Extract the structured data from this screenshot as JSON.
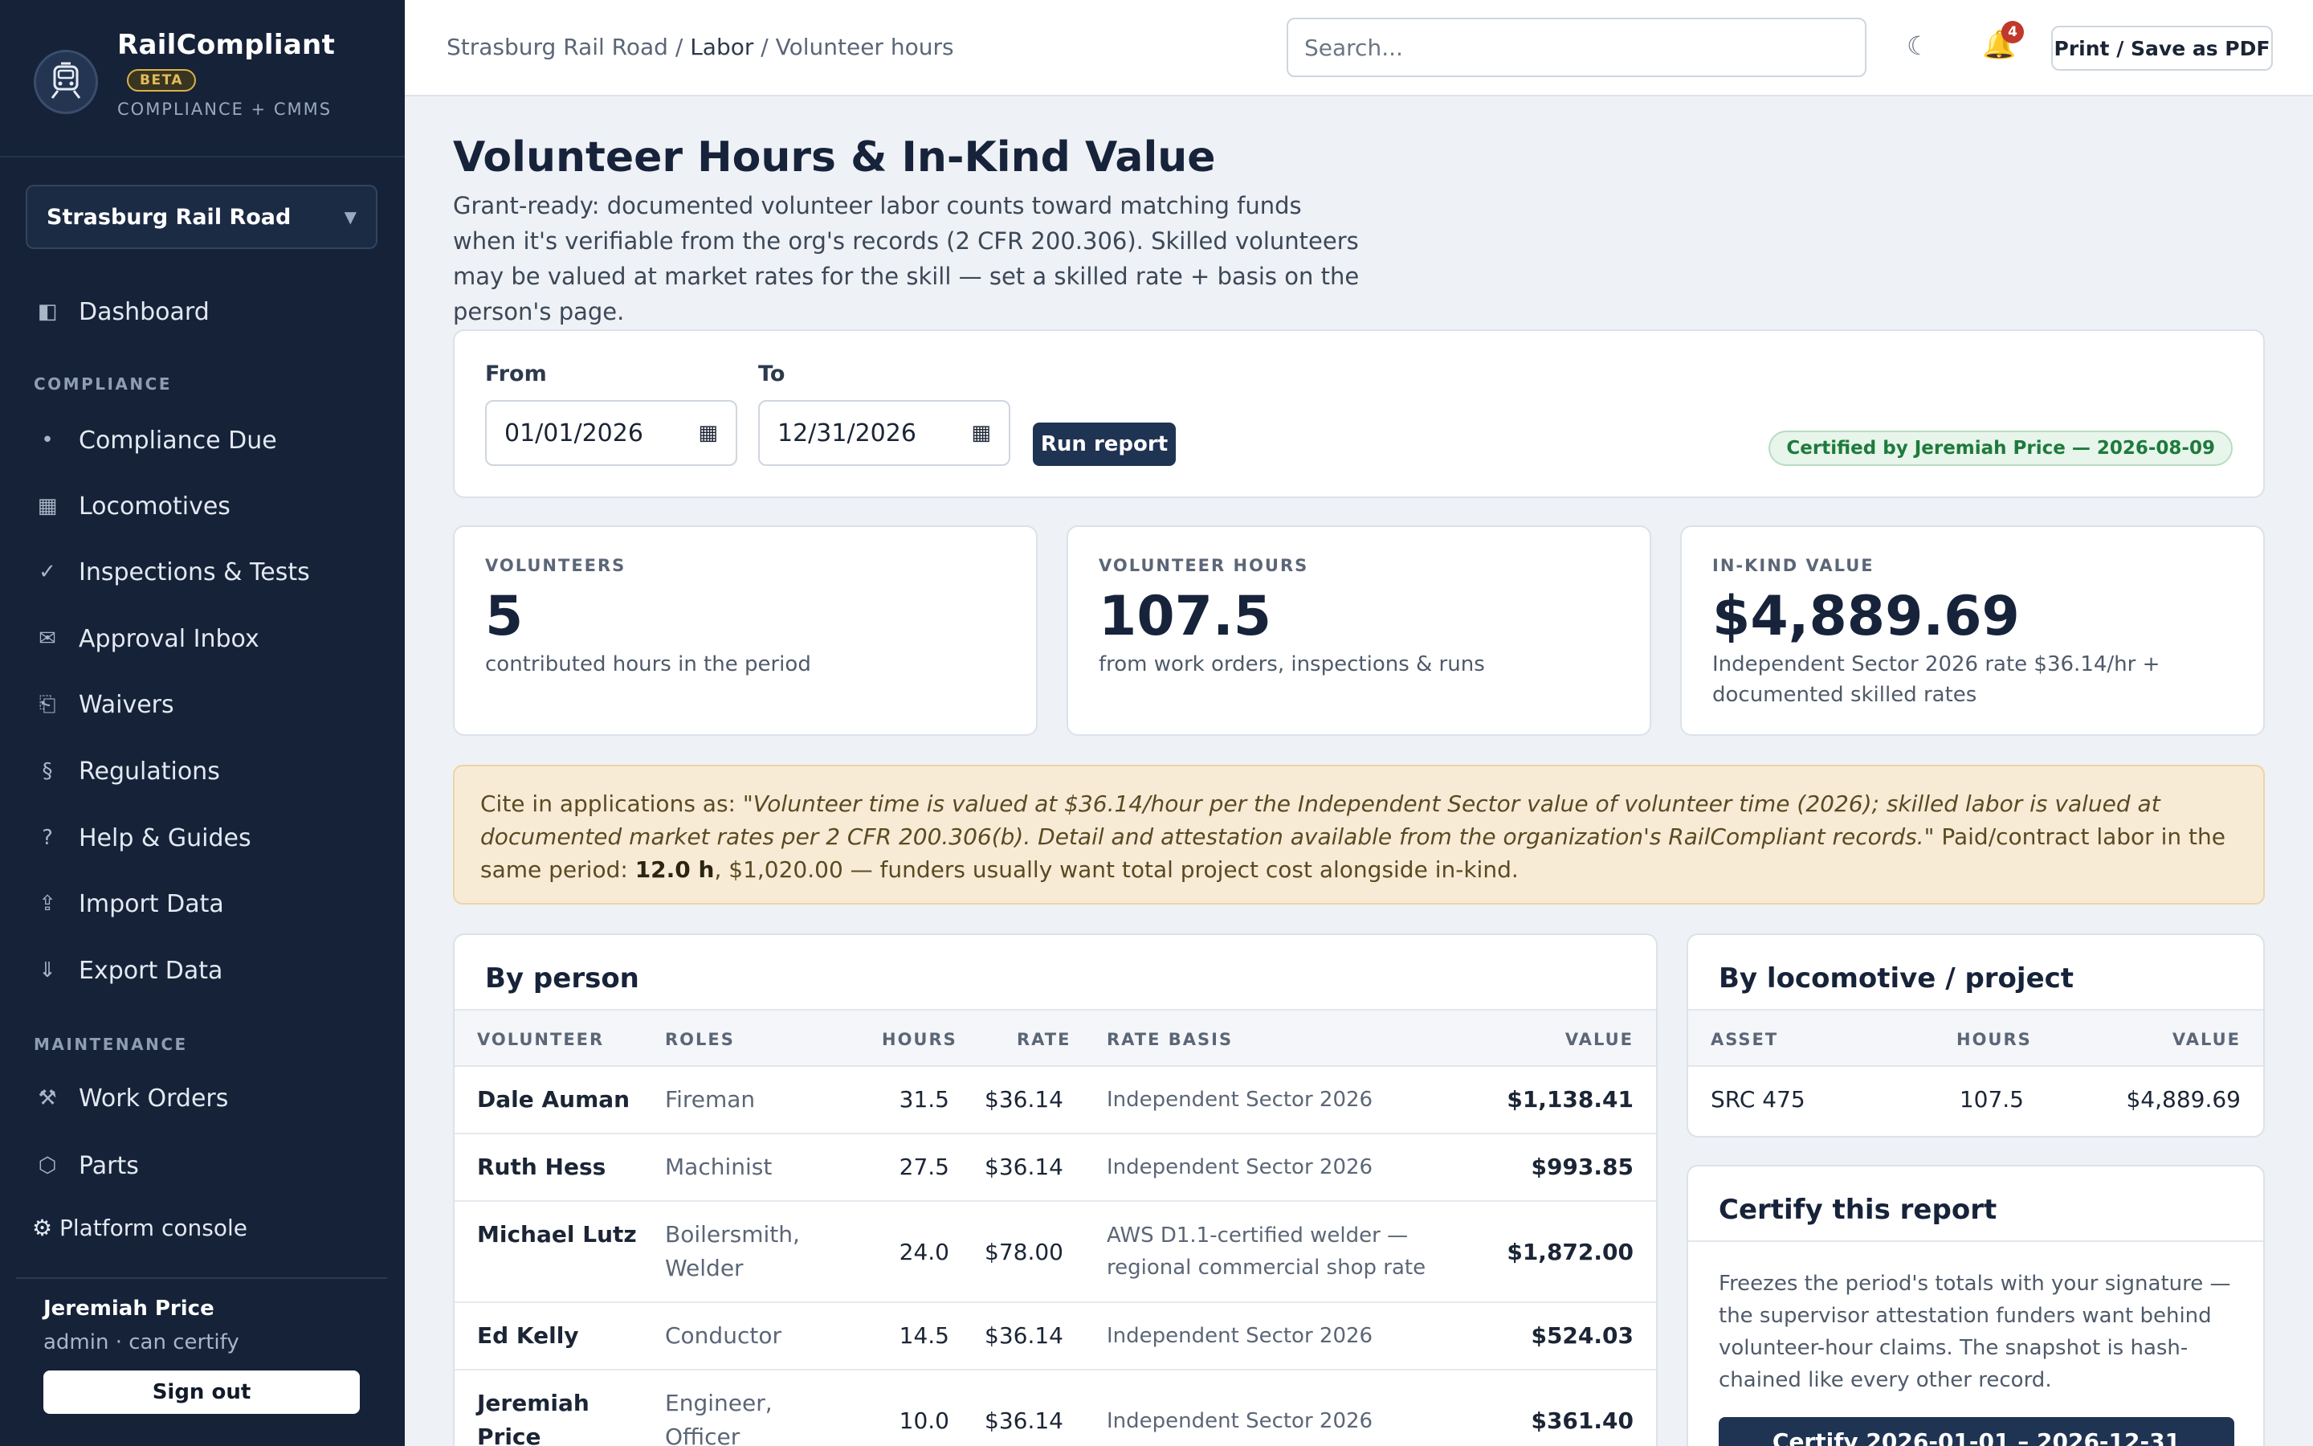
{
  "app": {
    "name": "RailCompliant",
    "beta": "BETA",
    "subtitle": "COMPLIANCE + CMMS",
    "logo_icon": "locomotive-badge-icon"
  },
  "sidebar": {
    "org": "Strasburg Rail Road",
    "items": {
      "dashboard": {
        "label": "Dashboard",
        "icon": "◧"
      },
      "compliance_due": {
        "label": "Compliance Due",
        "icon": "•"
      },
      "locomotives": {
        "label": "Locomotives",
        "icon": "▦"
      },
      "inspections": {
        "label": "Inspections & Tests",
        "icon": "✓"
      },
      "approval": {
        "label": "Approval Inbox",
        "icon": "✉"
      },
      "waivers": {
        "label": "Waivers",
        "icon": "⎗"
      },
      "regulations": {
        "label": "Regulations",
        "icon": "§"
      },
      "help": {
        "label": "Help & Guides",
        "icon": "?"
      },
      "import": {
        "label": "Import Data",
        "icon": "⇪"
      },
      "export": {
        "label": "Export Data",
        "icon": "⇓"
      },
      "work_orders": {
        "label": "Work Orders",
        "icon": "⚒"
      },
      "parts": {
        "label": "Parts",
        "icon": "⬡"
      }
    },
    "section_compliance": "COMPLIANCE",
    "section_maintenance": "MAINTENANCE",
    "platform_console": "⚙ Platform console",
    "user_name": "Jeremiah Price",
    "user_role": "admin · can certify",
    "sign_out": "Sign out"
  },
  "topbar": {
    "crumb_org": "Strasburg Rail Road /",
    "crumb_section": "Labor",
    "crumb_page": "/ Volunteer hours",
    "search_placeholder": "Search...",
    "notifications": "4",
    "print": "Print / Save as PDF"
  },
  "page": {
    "title": "Volunteer Hours & In-Kind Value",
    "description": "Grant-ready: documented volunteer labor counts toward matching funds when it's verifiable from the org's records (2 CFR 200.306). Skilled volunteers may be valued at market rates for the skill — set a skilled rate + basis on the person's page."
  },
  "filters": {
    "from_label": "From",
    "from_value": "01/01/2026",
    "to_label": "To",
    "to_value": "12/31/2026",
    "run": "Run report",
    "certified": "Certified by Jeremiah Price — 2026-08-09"
  },
  "stats": {
    "volunteers": {
      "label": "VOLUNTEERS",
      "value": "5",
      "sub": "contributed hours in the period"
    },
    "hours": {
      "label": "VOLUNTEER HOURS",
      "value": "107.5",
      "sub": "from work orders, inspections & runs"
    },
    "value": {
      "label": "IN-KIND VALUE",
      "value": "$4,889.69",
      "sub": "Independent Sector 2026 rate $36.14/hr + documented skilled rates"
    }
  },
  "notice": {
    "prefix": "Cite in applications as: ",
    "quote": "\"Volunteer time is valued at $36.14/hour per the Independent Sector value of volunteer time (2026); skilled labor is valued at documented market rates per 2 CFR 200.306(b). Detail and attestation available from the organization's RailCompliant records.\"",
    "middle": " Paid/contract labor in the same period: ",
    "paid_hours": "12.0 h",
    "suffix": ", $1,020.00 — funders usually want total project cost alongside in-kind."
  },
  "by_person": {
    "title": "By person",
    "headers": {
      "volunteer": "VOLUNTEER",
      "roles": "ROLES",
      "hours": "HOURS",
      "rate": "RATE",
      "basis": "RATE BASIS",
      "value": "VALUE"
    },
    "rows": [
      {
        "name": "Dale Auman",
        "roles": "Fireman",
        "hours": "31.5",
        "rate": "$36.14",
        "basis": "Independent Sector 2026",
        "value": "$1,138.41"
      },
      {
        "name": "Ruth Hess",
        "roles": "Machinist",
        "hours": "27.5",
        "rate": "$36.14",
        "basis": "Independent Sector 2026",
        "value": "$993.85"
      },
      {
        "name": "Michael Lutz",
        "roles": "Boilersmith, Welder",
        "hours": "24.0",
        "rate": "$78.00",
        "basis": "AWS D1.1-certified welder — regional commercial shop rate",
        "value": "$1,872.00"
      },
      {
        "name": "Ed Kelly",
        "roles": "Conductor",
        "hours": "14.5",
        "rate": "$36.14",
        "basis": "Independent Sector 2026",
        "value": "$524.03"
      },
      {
        "name": "Jeremiah Price",
        "roles": "Engineer, Officer",
        "hours": "10.0",
        "rate": "$36.14",
        "basis": "Independent Sector 2026",
        "value": "$361.40"
      }
    ]
  },
  "by_asset": {
    "title": "By locomotive / project",
    "headers": {
      "asset": "ASSET",
      "hours": "HOURS",
      "value": "VALUE"
    },
    "rows": [
      {
        "asset": "SRC 475",
        "hours": "107.5",
        "value": "$4,889.69"
      }
    ]
  },
  "certify": {
    "title": "Certify this report",
    "text": "Freezes the period's totals with your signature — the supervisor attestation funders want behind volunteer-hour claims. The snapshot is hash-chained like every other record.",
    "button": "Certify 2026-01-01 – 2026-12-31"
  }
}
